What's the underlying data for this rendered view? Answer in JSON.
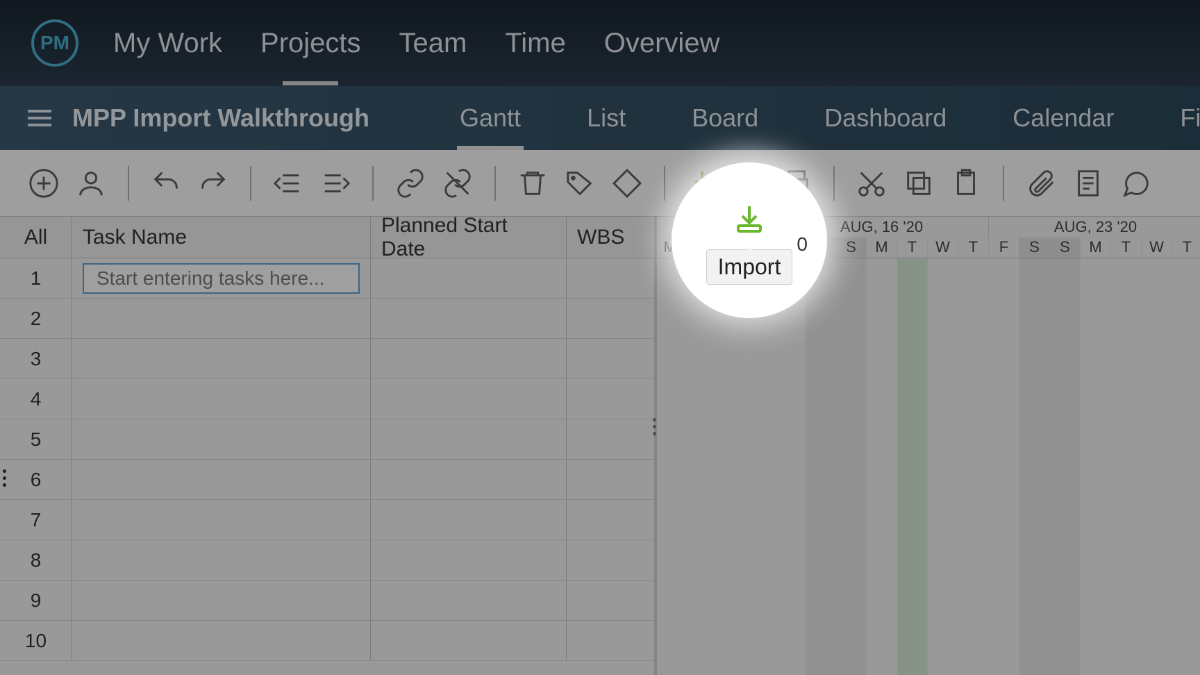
{
  "logo": "PM",
  "top_nav": [
    {
      "label": "My Work",
      "active": false
    },
    {
      "label": "Projects",
      "active": true
    },
    {
      "label": "Team",
      "active": false
    },
    {
      "label": "Time",
      "active": false
    },
    {
      "label": "Overview",
      "active": false
    }
  ],
  "project": {
    "title": "MPP Import Walkthrough"
  },
  "view_tabs": [
    {
      "label": "Gantt",
      "active": true
    },
    {
      "label": "List",
      "active": false
    },
    {
      "label": "Board",
      "active": false
    },
    {
      "label": "Dashboard",
      "active": false
    },
    {
      "label": "Calendar",
      "active": false
    },
    {
      "label": "Files",
      "active": false
    }
  ],
  "toolbar": {
    "tooltip_label": "Import",
    "overflow_digit": "0"
  },
  "grid": {
    "headers": {
      "all": "All",
      "name": "Task Name",
      "date": "Planned Start Date",
      "wbs": "WBS"
    },
    "rows": [
      1,
      2,
      3,
      4,
      5,
      6,
      7,
      8,
      9,
      10
    ],
    "first_row_placeholder": "Start entering tasks here..."
  },
  "timeline": {
    "weeks": [
      "",
      "AUG, 16 '20",
      "AUG, 23 '20"
    ],
    "days": [
      "M",
      "T",
      "W",
      "T",
      "F",
      "S",
      "S",
      "M",
      "T",
      "W",
      "T",
      "F",
      "S",
      "S",
      "M",
      "T",
      "W",
      "T"
    ]
  }
}
